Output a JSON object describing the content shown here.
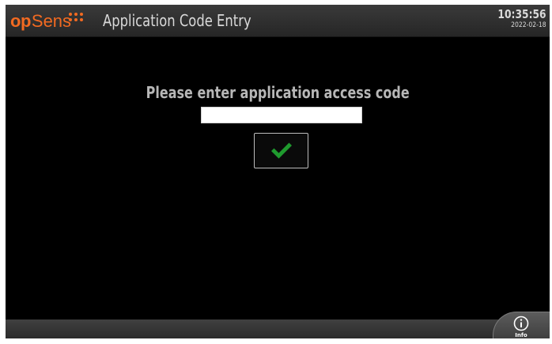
{
  "colors": {
    "brand_orange": "#f26a21",
    "title_text": "#d9d9d9",
    "prompt_text": "#b7b7b7",
    "confirm_green": "#1f9a2e",
    "white": "#ffffff"
  },
  "header": {
    "logo": {
      "part_op": "op",
      "part_sens": "Sens",
      "dots_icon": "logo-dots-icon"
    },
    "title": "Application Code Entry",
    "clock": {
      "time": "10:35:56",
      "date": "2022-02-18"
    }
  },
  "main": {
    "prompt": "Please enter application access code",
    "code_input": {
      "value": "",
      "placeholder": ""
    },
    "confirm_button": {
      "icon": "checkmark-icon"
    }
  },
  "footer": {
    "info_button": {
      "icon": "info-icon",
      "label": "Info"
    }
  }
}
